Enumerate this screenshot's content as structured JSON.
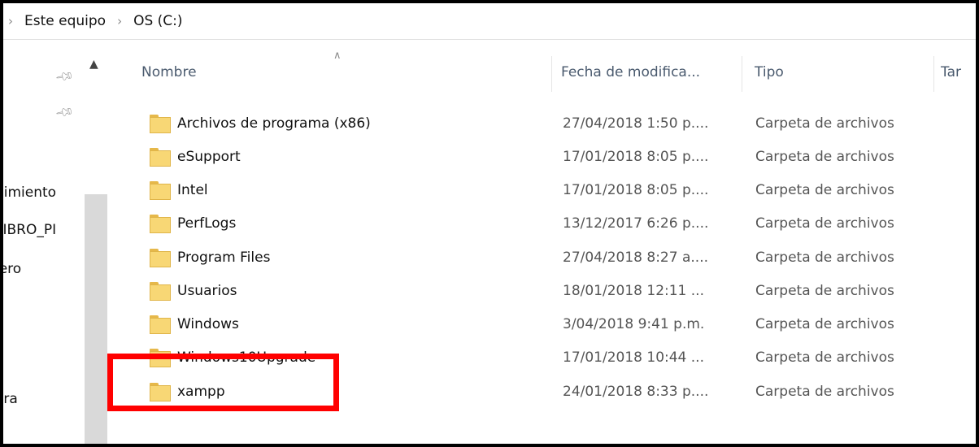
{
  "address_bar": {
    "crumbs": [
      "Este equipo",
      "OS (C:)"
    ]
  },
  "nav_pane": {
    "items": [
      "uimiento",
      "LIBRO_PI",
      "iero",
      "ara"
    ]
  },
  "columns": {
    "name": "Nombre",
    "date": "Fecha de modifica...",
    "type": "Tipo",
    "size": "Tar"
  },
  "rows": [
    {
      "name": "Archivos de programa (x86)",
      "date": "27/04/2018 1:50 p....",
      "type": "Carpeta de archivos"
    },
    {
      "name": "eSupport",
      "date": "17/01/2018 8:05 p....",
      "type": "Carpeta de archivos"
    },
    {
      "name": "Intel",
      "date": "17/01/2018 8:05 p....",
      "type": "Carpeta de archivos"
    },
    {
      "name": "PerfLogs",
      "date": "13/12/2017 6:26 p....",
      "type": "Carpeta de archivos"
    },
    {
      "name": "Program Files",
      "date": "27/04/2018 8:27 a....",
      "type": "Carpeta de archivos"
    },
    {
      "name": "Usuarios",
      "date": "18/01/2018 12:11 ...",
      "type": "Carpeta de archivos"
    },
    {
      "name": "Windows",
      "date": "3/04/2018 9:41 p.m.",
      "type": "Carpeta de archivos"
    },
    {
      "name": "Windows10Upgrade",
      "date": "17/01/2018 10:44 ...",
      "type": "Carpeta de archivos"
    },
    {
      "name": "xampp",
      "date": "24/01/2018 8:33 p....",
      "type": "Carpeta de archivos"
    }
  ],
  "colors": {
    "highlight": "#ff0000",
    "folder": "#f8d775"
  }
}
